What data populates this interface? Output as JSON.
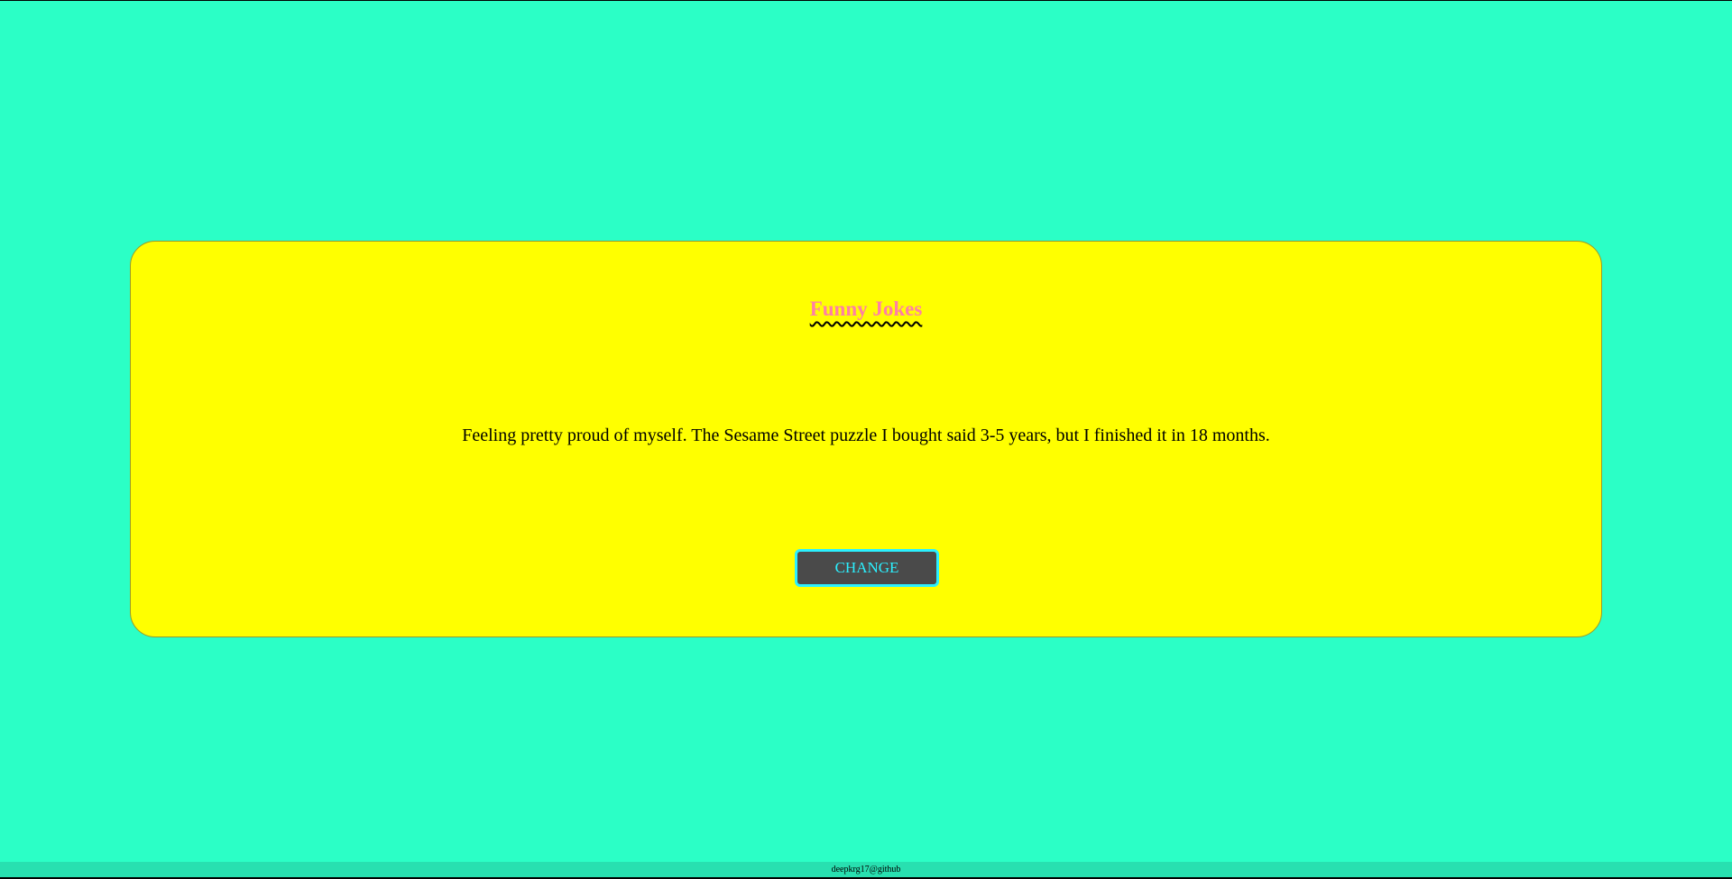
{
  "app": {
    "title": "Funny Jokes"
  },
  "joke": {
    "text": "Feeling pretty proud of myself. The Sesame Street puzzle I bought said 3-5 years, but I finished it in 18 months."
  },
  "actions": {
    "change_label": "CHANGE"
  },
  "footer": {
    "credit": "deepkrg17@github"
  },
  "colors": {
    "page_background": "#2bffc6",
    "card_background": "#ffff00",
    "title": "#ff7fa6",
    "button_background": "#4a4a4a",
    "button_text": "#2bf0ff"
  }
}
